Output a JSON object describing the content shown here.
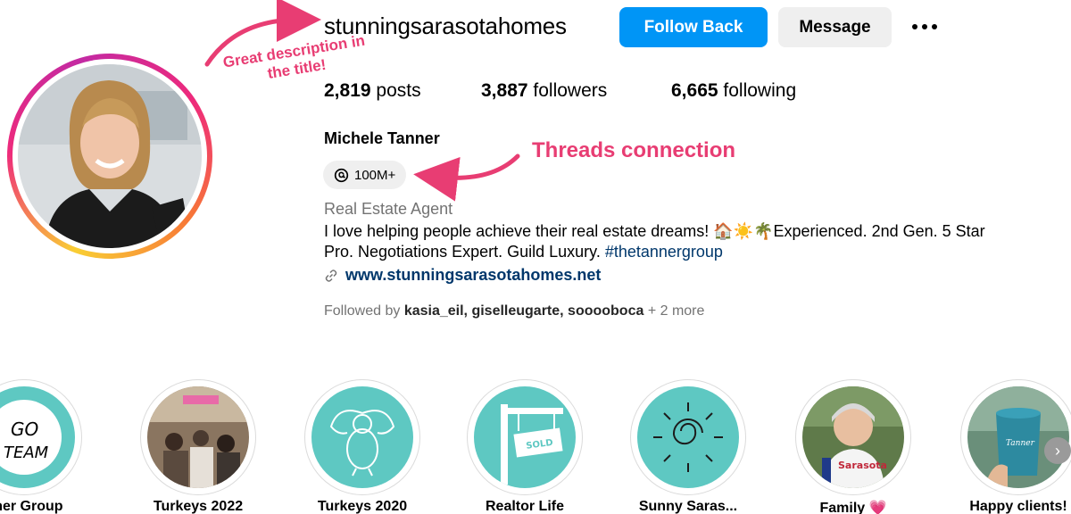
{
  "profile": {
    "username": "stunningsarasotahomes",
    "follow_button": "Follow Back",
    "message_button": "Message",
    "stats": {
      "posts_count": "2,819",
      "posts_label": "posts",
      "followers_count": "3,887",
      "followers_label": "followers",
      "following_count": "6,665",
      "following_label": "following"
    },
    "full_name": "Michele Tanner",
    "threads_badge": "100M+",
    "category": "Real Estate Agent",
    "bio_line1": "I love helping people achieve their real estate dreams! 🏠☀️🌴Experienced. 2nd Gen. 5 Star",
    "bio_line2_text": "Pro. Negotiations Expert. Guild Luxury. ",
    "bio_hashtag": "#thetannergroup",
    "website": "www.stunningsarasotahomes.net",
    "followed_by_prefix": "Followed by ",
    "followed_by_names": "kasia_eil, giselleugarte, sooooboca",
    "followed_by_more": " + 2 more"
  },
  "annotations": {
    "title_note": "Great description in the title!",
    "threads_note": "Threads connection",
    "color": "#e83d73"
  },
  "highlights": [
    {
      "label": "nner Group"
    },
    {
      "label": "Turkeys 2022"
    },
    {
      "label": "Turkeys 2020"
    },
    {
      "label": "Realtor Life"
    },
    {
      "label": "Sunny Saras..."
    },
    {
      "label": "Family 💗"
    },
    {
      "label": "Happy clients!"
    }
  ],
  "colors": {
    "primary": "#0095f6",
    "link": "#00376b",
    "teal": "#5ec8c2"
  }
}
